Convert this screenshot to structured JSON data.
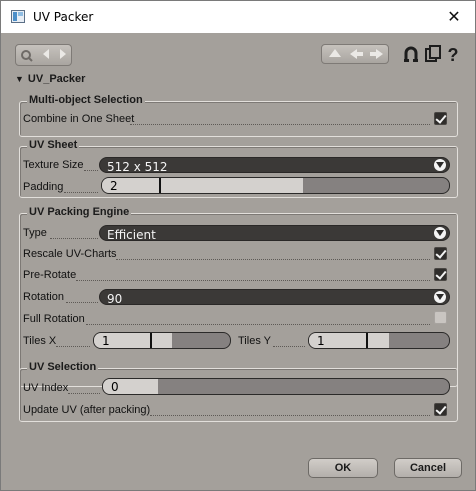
{
  "window": {
    "title": "UV Packer",
    "close_glyph": "✕"
  },
  "rollout": {
    "title": "UV_Packer",
    "arrow": "▼"
  },
  "groups": {
    "multi": {
      "title": "Multi-object Selection",
      "combine_label": "Combine in One Sheet",
      "combine_checked": true
    },
    "sheet": {
      "title": "UV Sheet",
      "texture_label": "Texture Size",
      "texture_value": "512 x 512",
      "padding_label": "Padding",
      "padding_value": "2",
      "padding_level": 0.27
    },
    "engine": {
      "title": "UV Packing Engine",
      "type_label": "Type",
      "type_value": "Efficient",
      "rescale_label": "Rescale UV-Charts",
      "rescale_checked": true,
      "prerotate_label": "Pre-Rotate",
      "prerotate_checked": true,
      "rotation_label": "Rotation",
      "rotation_value": "90",
      "fullrot_label": "Full Rotation",
      "fullrot_checked": false,
      "tilesx_label": "Tiles X",
      "tilesx_value": "1",
      "tilesx_level": 0.45,
      "tilesy_label": "Tiles Y",
      "tilesy_value": "1",
      "tilesy_level": 0.45
    },
    "selection": {
      "title": "UV Selection",
      "index_label": "UV Index",
      "index_value": "0",
      "index_level": 0.16,
      "update_label": "Update UV (after packing)",
      "update_checked": true
    }
  },
  "buttons": {
    "ok": "OK",
    "cancel": "Cancel"
  },
  "toolbar": {
    "icons": [
      "pin-icon",
      "arrow-left-icon",
      "arrow-right-icon",
      "arrow-up-icon",
      "arrow-left-icon",
      "arrow-right-icon",
      "magnet-icon",
      "copy-icon",
      "help-icon"
    ],
    "help_glyph": "?"
  }
}
